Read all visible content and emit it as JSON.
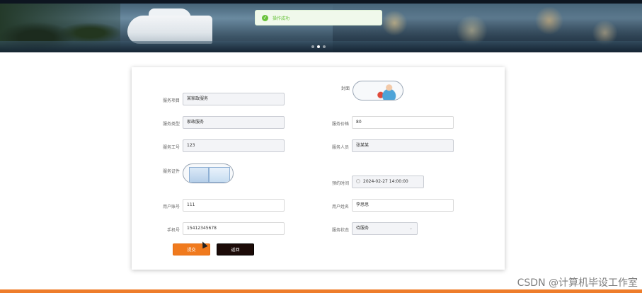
{
  "toast": {
    "message": "操作成功",
    "icon": "check-circle-icon",
    "color": "#67c23a"
  },
  "carousel": {
    "dot_count": 3,
    "active_index": 1
  },
  "form": {
    "cover_label": "封面",
    "service_item_label": "服务项目",
    "service_item_value": "某家政服务",
    "service_type_label": "服务类型",
    "service_type_value": "家政服务",
    "service_price_label": "服务价格",
    "service_price_value": "80",
    "service_no_label": "服务工号",
    "service_no_value": "123",
    "service_staff_label": "服务人员",
    "service_staff_value": "张某某",
    "certificate_label": "服务证件",
    "appointment_label": "预约时间",
    "appointment_value": "2024-02-27 14:00:00",
    "user_account_label": "用户账号",
    "user_account_value": "111",
    "user_name_label": "用户姓名",
    "user_name_value": "李思思",
    "phone_label": "手机号",
    "phone_value": "15412345678",
    "status_label": "服务状态",
    "status_value": "待服务",
    "submit_label": "提交",
    "back_label": "返回"
  },
  "colors": {
    "accent": "#f07a1e",
    "footer": "#ee7d2b",
    "dark_button": "#1c0b08"
  },
  "watermark": "CSDN @计算机毕设工作室"
}
